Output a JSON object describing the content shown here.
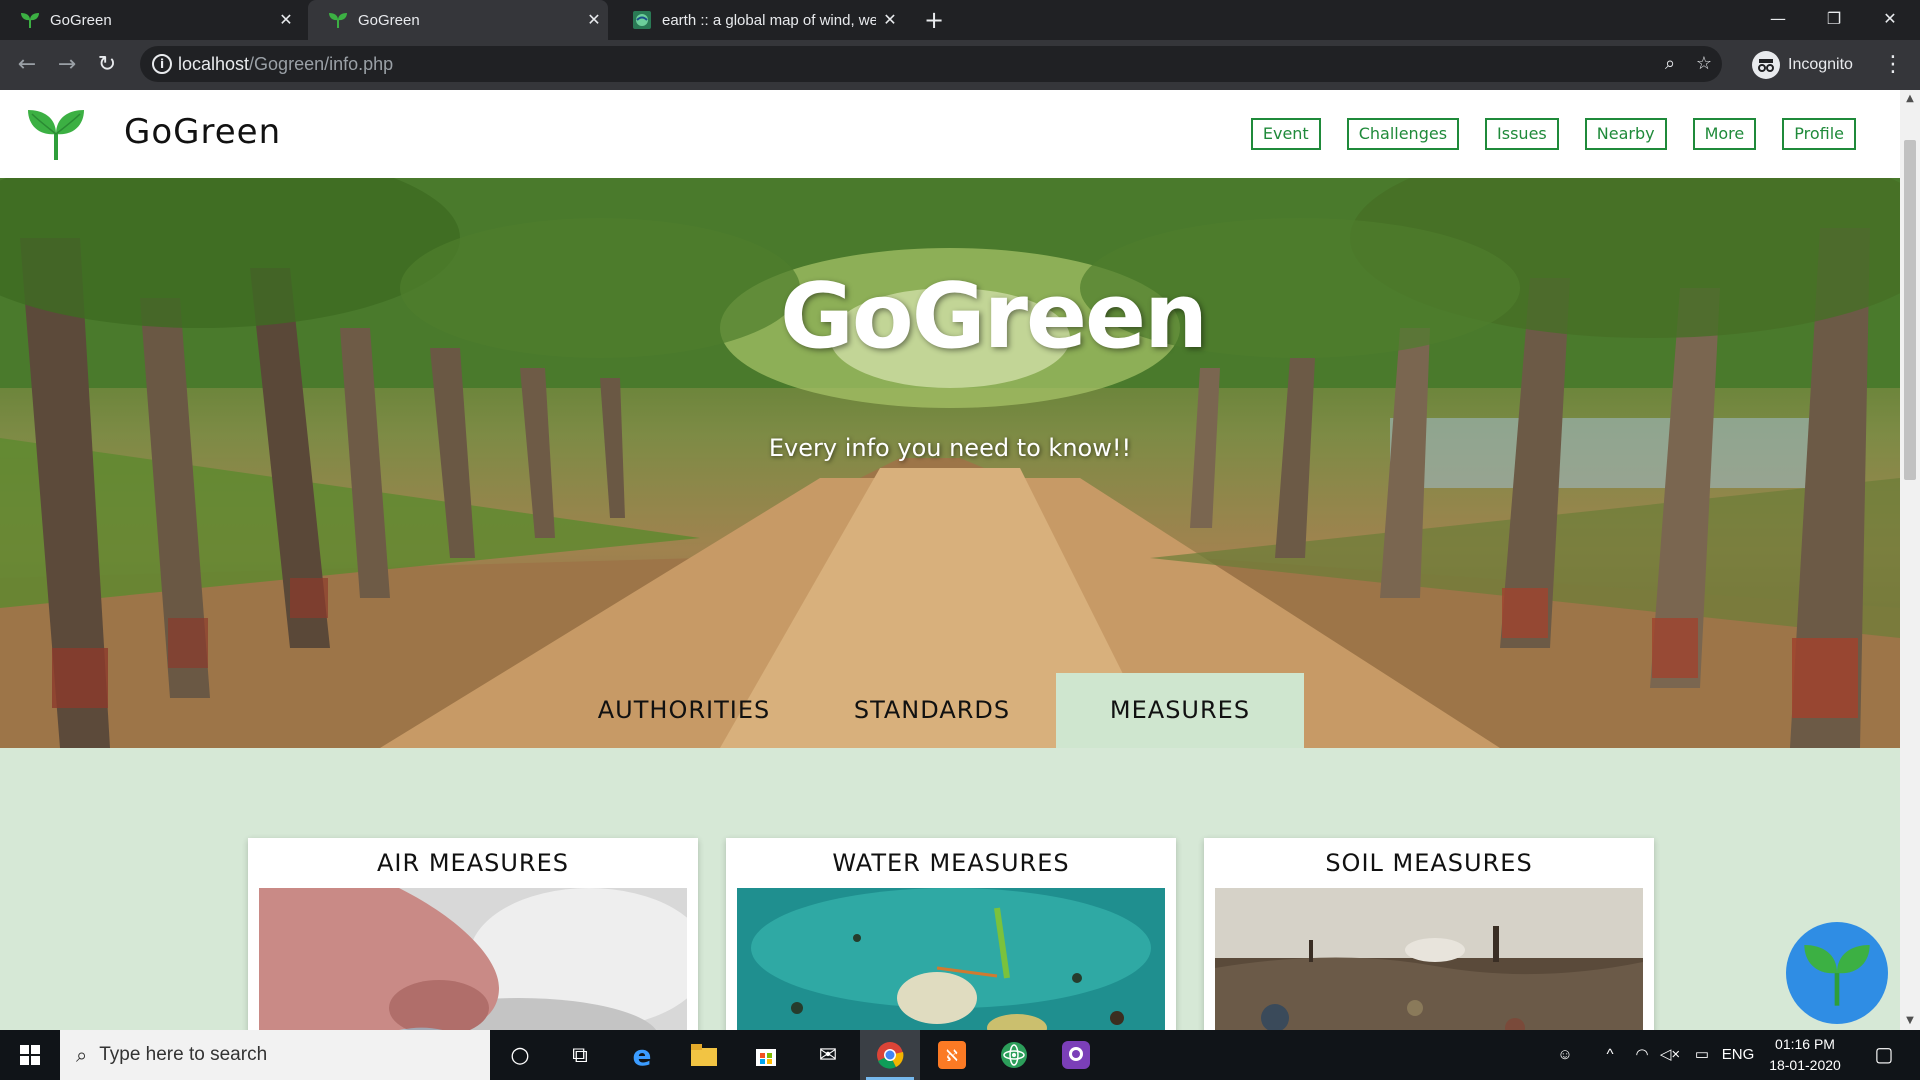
{
  "browser": {
    "tabs": [
      {
        "title": "GoGreen",
        "icon": "gogreen-leaf-icon"
      },
      {
        "title": "GoGreen",
        "icon": "gogreen-leaf-icon"
      },
      {
        "title": "earth :: a global map of wind, we",
        "icon": "earth-icon"
      }
    ],
    "active_tab": 1,
    "url_host": "localhost",
    "url_path": "/Gogreen/info.php",
    "profile_label": "Incognito"
  },
  "site": {
    "brand": "GoGreen",
    "nav": [
      "Event",
      "Challenges",
      "Issues",
      "Nearby",
      "More",
      "Profile"
    ],
    "accent_color": "#1f8a3a"
  },
  "hero": {
    "title": "GoGreen",
    "subtitle": "Every info you need to know!!"
  },
  "tabs": [
    {
      "label": "AUTHORITIES",
      "active": false
    },
    {
      "label": "STANDARDS",
      "active": false
    },
    {
      "label": "MEASURES",
      "active": true
    }
  ],
  "cards": [
    {
      "title": "AIR MEASURES",
      "image": "nose-smog-image"
    },
    {
      "title": "WATER MEASURES",
      "image": "polluted-water-image"
    },
    {
      "title": "SOIL MEASURES",
      "image": "landfill-image"
    }
  ],
  "taskbar": {
    "search_placeholder": "Type here to search",
    "language": "ENG",
    "time": "01:16 PM",
    "date": "18-01-2020"
  }
}
